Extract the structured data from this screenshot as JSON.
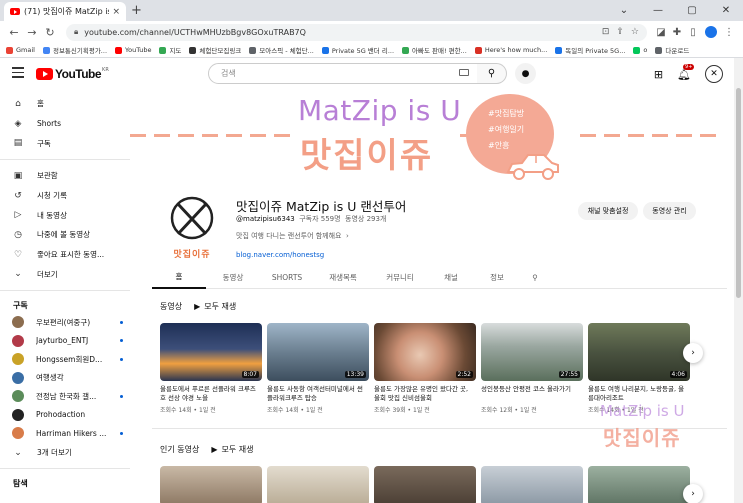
{
  "browser": {
    "tab_title": "(71) 맛집이쥬 MatZip is U 랜선...",
    "tab_close": "×",
    "new_tab": "+",
    "url": "youtube.com/channel/UCTHwMHUzbBgv8GOxuTRAB7Q",
    "bookmarks": [
      "Gmail",
      "정보통신기획평가...",
      "YouTube",
      "지도",
      "체험단모집링크",
      "모아스픽 - 체험단...",
      "Private 5G 밴더 리...",
      "아빠도 판매! 편한...",
      "Here's how much...",
      "독일의 Private 5G...",
      "o",
      "다운로드"
    ]
  },
  "yt": {
    "logo": "YouTube",
    "logo_sup": "KR",
    "search_placeholder": "검색",
    "notif_count": "9+"
  },
  "sidebar": {
    "main": [
      {
        "label": "홈",
        "icon": "home-icon",
        "glyph": "⌂"
      },
      {
        "label": "Shorts",
        "icon": "shorts-icon",
        "glyph": "◈"
      },
      {
        "label": "구독",
        "icon": "subscriptions-icon",
        "glyph": "▤"
      }
    ],
    "library": [
      {
        "label": "보관함",
        "icon": "library-icon",
        "glyph": "▣"
      },
      {
        "label": "시청 기록",
        "icon": "history-icon",
        "glyph": "↺"
      },
      {
        "label": "내 동영상",
        "icon": "my-videos-icon",
        "glyph": "▷"
      },
      {
        "label": "나중에 볼 동영상",
        "icon": "watch-later-icon",
        "glyph": "◷"
      },
      {
        "label": "좋아요 표시한 동영...",
        "icon": "liked-icon",
        "glyph": "♡"
      },
      {
        "label": "더보기",
        "icon": "chevron-down-icon",
        "glyph": "⌄"
      }
    ],
    "subs_heading": "구독",
    "subs": [
      {
        "name": "우보편리(여중구)",
        "color": "#8c6d4f"
      },
      {
        "name": "Jayturbo_ENTJ",
        "color": "#b23a48"
      },
      {
        "name": "Hongssem회원D...",
        "color": "#c9a227"
      },
      {
        "name": "여행생각",
        "color": "#3a6ea5"
      },
      {
        "name": "전정남 한국화 갤...",
        "color": "#5b8c5a"
      },
      {
        "name": "Prohodaction",
        "color": "#222222"
      },
      {
        "name": "Harriman Hikers ...",
        "color": "#d87c4a"
      }
    ],
    "subs_more": "3개 더보기",
    "explore_heading": "탐색"
  },
  "banner": {
    "title_en": "MatZip is U",
    "title_ko": "맛집이쥬",
    "tags": [
      "#맛집탐방",
      "#여행일기",
      "#안흥"
    ]
  },
  "channel": {
    "avatar_text": "맛집이쥬",
    "name": "맛집이쥬 MatZip is U 랜선투어",
    "handle": "@matzipisu6343",
    "subs": "구독자 559명",
    "videos": "동영상 293개",
    "description": "맛집 여행 다니는 랜선투어 함께해요",
    "link": "blog.naver.com/honestsg",
    "customize_btn": "채널 맞춤설정",
    "manage_btn": "동영상 관리"
  },
  "tabs": [
    "홈",
    "동영상",
    "SHORTS",
    "재생목록",
    "커뮤니티",
    "채널",
    "정보"
  ],
  "shelf1": {
    "title": "동영상",
    "play_all": "모두 재생",
    "videos": [
      {
        "title": "울릉도에서 푸르른 선플라워 크루즈호 선상 야경 노을",
        "meta": "조회수 14회 • 1일 전",
        "dur": "8:07"
      },
      {
        "title": "울릉도 사동항 여객선터미널에서 썬플라워크루즈 탑승",
        "meta": "조회수 14회 • 1일 전",
        "dur": "13:39"
      },
      {
        "title": "울릉도 가장많은 유명인 왔다간 곳, 울회 맛집 신비섬울회",
        "meta": "조회수 39회 • 1일 전",
        "dur": "2:52"
      },
      {
        "title": "성인봉등산 안평전 코스 올라가기",
        "meta": "조회수 12회 • 1일 전",
        "dur": "27:55"
      },
      {
        "title": "울릉도 여행 나리분지, 노랑등굴, 울릉대아리조트",
        "meta": "조회수 14회 • 1일 전",
        "dur": "4:06"
      }
    ]
  },
  "shelf2": {
    "title": "인기 동영상",
    "play_all": "모두 재생"
  },
  "watermark": {
    "en": "MatZip is U",
    "ko": "맛집이쥬"
  },
  "colors": {
    "brand_red": "#ff0000",
    "banner_purple": "#b87fd6",
    "banner_peach": "#f39f86"
  }
}
